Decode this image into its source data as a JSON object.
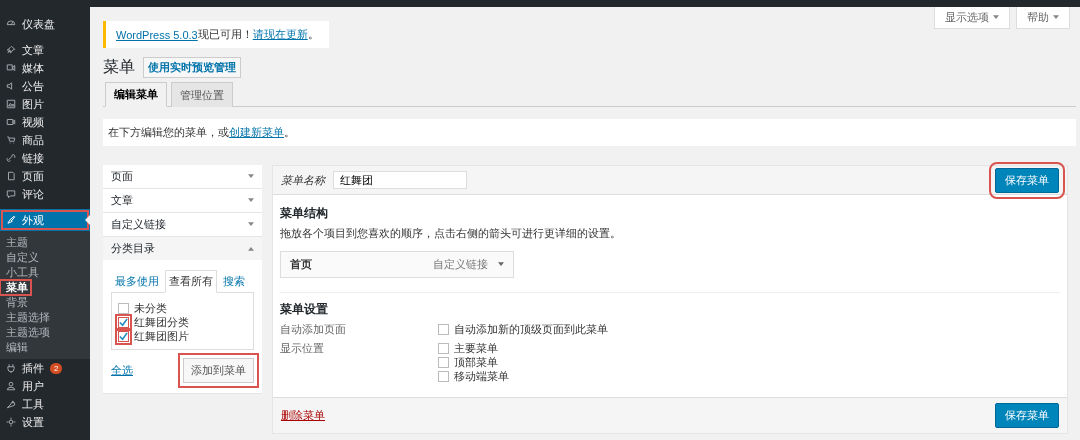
{
  "sidebar": {
    "items": [
      {
        "label": "仪表盘",
        "selected": false,
        "highlighted": false
      },
      {
        "label": "文章",
        "selected": false,
        "highlighted": false
      },
      {
        "label": "媒体",
        "selected": false,
        "highlighted": false
      },
      {
        "label": "公告",
        "selected": false,
        "highlighted": false
      },
      {
        "label": "图片",
        "selected": false,
        "highlighted": false
      },
      {
        "label": "视频",
        "selected": false,
        "highlighted": false
      },
      {
        "label": "商品",
        "selected": false,
        "highlighted": false
      },
      {
        "label": "链接",
        "selected": false,
        "highlighted": false
      },
      {
        "label": "页面",
        "selected": false,
        "highlighted": false
      },
      {
        "label": "评论",
        "selected": false,
        "highlighted": false
      },
      {
        "label": "外观",
        "selected": true,
        "highlighted": true,
        "children": [
          {
            "label": "主题",
            "selected": false,
            "highlighted": false
          },
          {
            "label": "自定义",
            "selected": false,
            "highlighted": false
          },
          {
            "label": "小工具",
            "selected": false,
            "highlighted": false
          },
          {
            "label": "菜单",
            "selected": true,
            "highlighted": true
          },
          {
            "label": "背景",
            "selected": false,
            "highlighted": false
          },
          {
            "label": "主题选择",
            "selected": false,
            "highlighted": false
          },
          {
            "label": "主题选项",
            "selected": false,
            "highlighted": false
          },
          {
            "label": "编辑",
            "selected": false,
            "highlighted": false
          }
        ]
      },
      {
        "label": "插件",
        "badge": "2",
        "selected": false,
        "highlighted": false
      },
      {
        "label": "用户",
        "selected": false,
        "highlighted": false
      },
      {
        "label": "工具",
        "selected": false,
        "highlighted": false
      },
      {
        "label": "设置",
        "selected": false,
        "highlighted": false
      }
    ]
  },
  "screen_meta": [
    "显示选项",
    "帮助"
  ],
  "notice": {
    "link": "WordPress 5.0.3",
    "text": "现已可用！",
    "action": "请现在更新",
    "end": "。"
  },
  "page": {
    "title": "菜单",
    "title_action": "使用实时预览管理"
  },
  "tabs": [
    {
      "label": "编辑菜单",
      "selected": true
    },
    {
      "label": "管理位置",
      "selected": false
    }
  ],
  "info": {
    "text": "在下方编辑您的菜单，或",
    "link": "创建新菜单",
    "end": "。"
  },
  "accordion": [
    {
      "title": "页面",
      "expanded": false
    },
    {
      "title": "文章",
      "expanded": false
    },
    {
      "title": "自定义链接",
      "expanded": false
    },
    {
      "title": "分类目录",
      "expanded": true,
      "tabs": [
        {
          "label": "最多使用",
          "selected": false
        },
        {
          "label": "查看所有",
          "selected": true
        },
        {
          "label": "搜索",
          "selected": false
        }
      ],
      "items": [
        {
          "label": "未分类",
          "checked": false,
          "highlighted": false
        },
        {
          "label": "红舞团分类",
          "checked": true,
          "highlighted": true
        },
        {
          "label": "红舞团图片",
          "checked": true,
          "highlighted": true
        }
      ],
      "select_all": "全选",
      "add_button": {
        "label": "添加到菜单",
        "highlighted": true
      }
    }
  ],
  "menu_editor": {
    "name_label": "菜单名称",
    "name_value": "红舞团",
    "save_top": {
      "label": "保存菜单",
      "highlighted": true
    },
    "structure": {
      "heading": "菜单结构",
      "description": "拖放各个项目到您喜欢的顺序，点击右侧的箭头可进行更详细的设置。",
      "items": [
        {
          "title": "首页",
          "type": "自定义链接"
        }
      ]
    },
    "settings": {
      "heading": "菜单设置",
      "rows": [
        {
          "label": "自动添加页面",
          "options": [
            {
              "label": "自动添加新的顶级页面到此菜单",
              "checked": false
            }
          ]
        },
        {
          "label": "显示位置",
          "options": [
            {
              "label": "主要菜单",
              "checked": false
            },
            {
              "label": "顶部菜单",
              "checked": false
            },
            {
              "label": "移动端菜单",
              "checked": false
            }
          ]
        }
      ]
    },
    "delete": "删除菜单",
    "save_bottom": {
      "label": "保存菜单",
      "highlighted": false
    }
  }
}
